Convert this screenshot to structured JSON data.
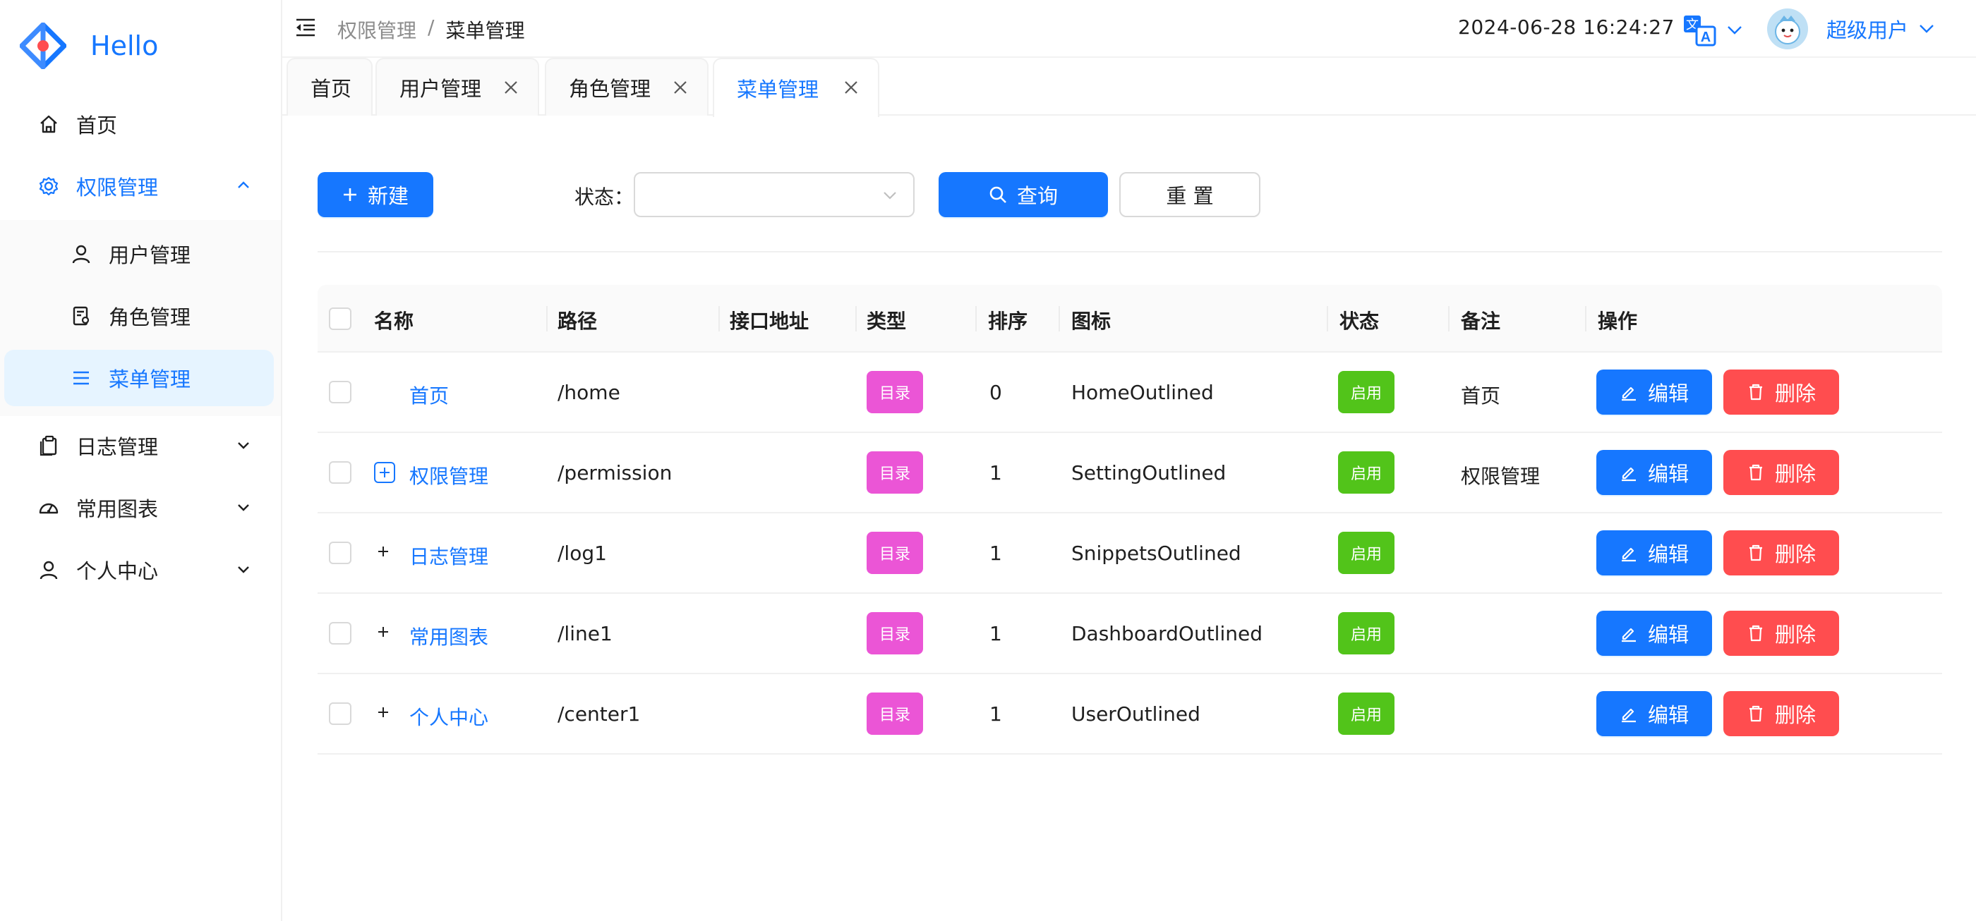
{
  "brand": {
    "name": "Hello",
    "color": "#1677ff"
  },
  "sidebar": {
    "items": [
      {
        "label": "首页",
        "icon": "home-icon"
      },
      {
        "label": "权限管理",
        "icon": "setting-icon",
        "expanded": true
      },
      {
        "label": "用户管理",
        "icon": "user-icon",
        "sub": true
      },
      {
        "label": "角色管理",
        "icon": "role-icon",
        "sub": true
      },
      {
        "label": "菜单管理",
        "icon": "menu-icon",
        "sub": true,
        "active": true
      },
      {
        "label": "日志管理",
        "icon": "snippets-icon"
      },
      {
        "label": "常用图表",
        "icon": "dashboard-icon"
      },
      {
        "label": "个人中心",
        "icon": "user-icon"
      }
    ]
  },
  "header": {
    "breadcrumb_parent": "权限管理",
    "breadcrumb_sep": "/",
    "breadcrumb_current": "菜单管理",
    "datetime": "2024-06-28 16:24:27",
    "user_name": "超级用户"
  },
  "tabs": [
    {
      "label": "首页",
      "closable": false
    },
    {
      "label": "用户管理",
      "closable": true
    },
    {
      "label": "角色管理",
      "closable": true
    },
    {
      "label": "菜单管理",
      "closable": true,
      "active": true
    }
  ],
  "toolbar": {
    "new_label": "新建",
    "status_label": "状态：",
    "status_value": "",
    "query_label": "查询",
    "reset_label": "重 置"
  },
  "table": {
    "columns": [
      "名称",
      "路径",
      "接口地址",
      "类型",
      "排序",
      "图标",
      "状态",
      "备注",
      "操作"
    ],
    "rows": [
      {
        "name": "首页",
        "path": "/home",
        "api": "",
        "type": "目录",
        "order": "0",
        "icon": "HomeOutlined",
        "status": "启用",
        "remark": "首页",
        "expandable": false
      },
      {
        "name": "权限管理",
        "path": "/permission",
        "api": "",
        "type": "目录",
        "order": "1",
        "icon": "SettingOutlined",
        "status": "启用",
        "remark": "权限管理",
        "expandable": true
      },
      {
        "name": "日志管理",
        "path": "/log1",
        "api": "",
        "type": "目录",
        "order": "1",
        "icon": "SnippetsOutlined",
        "status": "启用",
        "remark": "",
        "expandable": true
      },
      {
        "name": "常用图表",
        "path": "/line1",
        "api": "",
        "type": "目录",
        "order": "1",
        "icon": "DashboardOutlined",
        "status": "启用",
        "remark": "",
        "expandable": true
      },
      {
        "name": "个人中心",
        "path": "/center1",
        "api": "",
        "type": "目录",
        "order": "1",
        "icon": "UserOutlined",
        "status": "启用",
        "remark": "",
        "expandable": true
      }
    ],
    "edit_label": "编辑",
    "delete_label": "删除"
  },
  "colors": {
    "primary": "#1677ff",
    "danger": "#ff4d4f",
    "success": "#52c41a",
    "magenta": "#eb55d6"
  }
}
